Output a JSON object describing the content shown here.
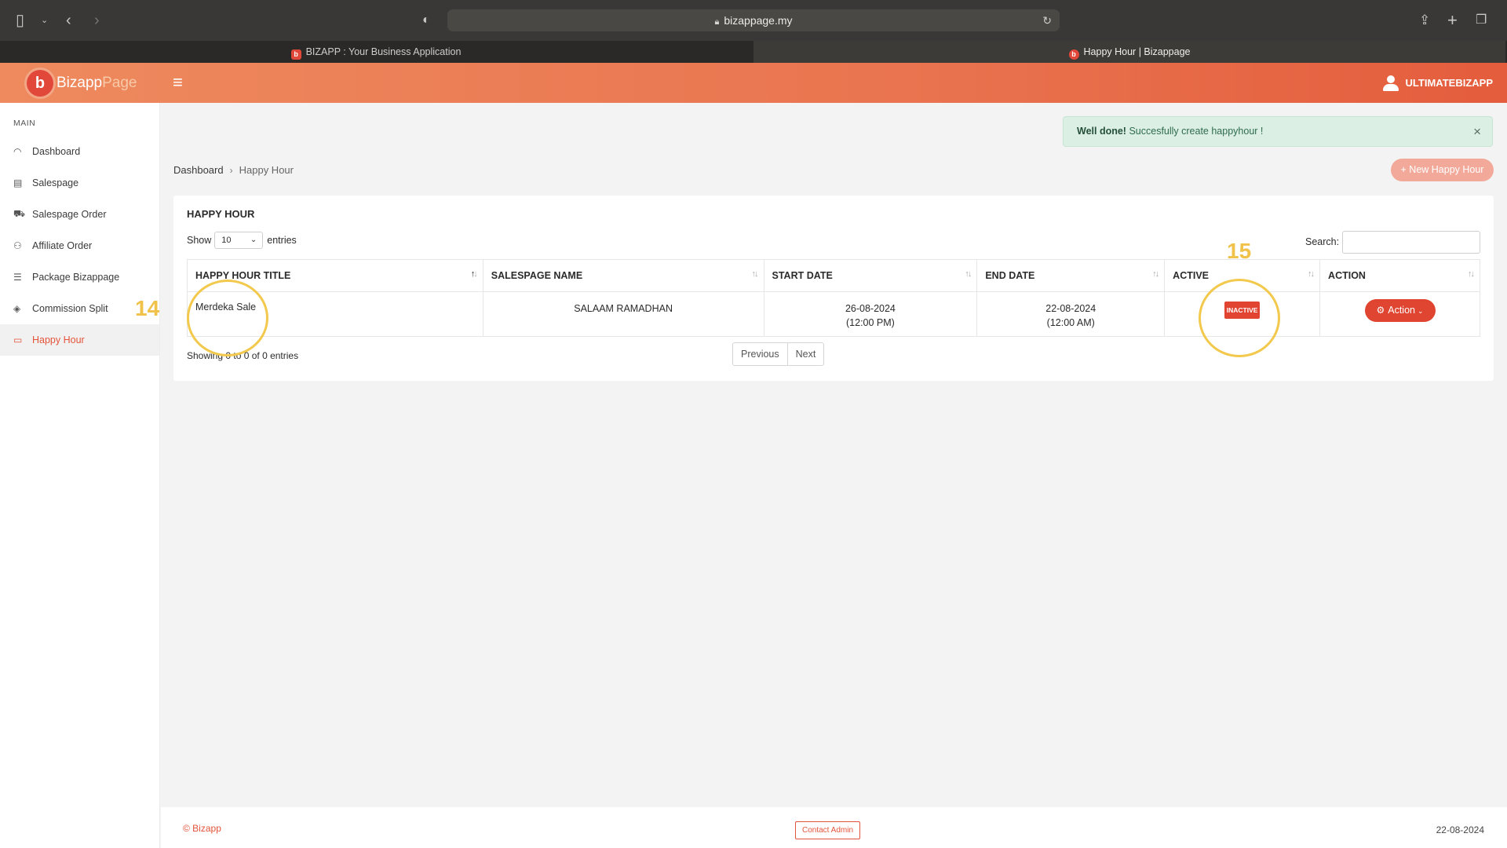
{
  "browser": {
    "url": "bizappage.my",
    "tabs": [
      {
        "title": "BIZAPP : Your Business Application",
        "active": false
      },
      {
        "title": "Happy Hour | Bizappage",
        "active": true
      }
    ]
  },
  "header": {
    "brand_main": "Bizapp",
    "brand_accent": "Page",
    "username": "ULTIMATEBIZAPP"
  },
  "sidebar": {
    "section": "MAIN",
    "items": [
      {
        "label": "Dashboard",
        "icon": "gauge-icon"
      },
      {
        "label": "Salespage",
        "icon": "calendar-icon"
      },
      {
        "label": "Salespage Order",
        "icon": "cart-icon"
      },
      {
        "label": "Affiliate Order",
        "icon": "users-icon"
      },
      {
        "label": "Package Bizappage",
        "icon": "list-icon"
      },
      {
        "label": "Commission Split",
        "icon": "diamond-icon"
      },
      {
        "label": "Happy Hour",
        "icon": "ticket-icon",
        "active": true
      }
    ]
  },
  "alert": {
    "strong": "Well done!",
    "message": "Succesfully create happyhour !"
  },
  "breadcrumb": {
    "root": "Dashboard",
    "current": "Happy Hour"
  },
  "new_button": "+ New Happy Hour",
  "card": {
    "title": "HAPPY HOUR",
    "show_label": "Show",
    "page_size": "10",
    "entries_label": "entries",
    "search_label": "Search:",
    "search_value": ""
  },
  "table": {
    "columns": [
      "HAPPY HOUR TITLE",
      "SALESPAGE NAME",
      "START DATE",
      "END DATE",
      "ACTIVE",
      "ACTION"
    ],
    "rows": [
      {
        "title": "Merdeka Sale",
        "salespage": "SALAAM RAMADHAN",
        "start_date": "26-08-2024",
        "start_time": "(12:00 PM)",
        "end_date": "22-08-2024",
        "end_time": "(12:00 AM)",
        "status": "INACTIVE",
        "action": "Action"
      }
    ],
    "info": "Showing 0 to 0 of 0 entries",
    "prev": "Previous",
    "next": "Next"
  },
  "annotations": {
    "label_14": "14",
    "label_15": "15",
    "color": "#f2c94c"
  },
  "footer": {
    "copyright": "© Bizapp",
    "contact": "Contact Admin",
    "date": "22-08-2024"
  },
  "colors": {
    "accent": "#e4543b",
    "header_start": "#ee8a5e",
    "header_end": "#e45d3d",
    "alert_bg": "#dcefe5",
    "badge": "#e14431"
  }
}
